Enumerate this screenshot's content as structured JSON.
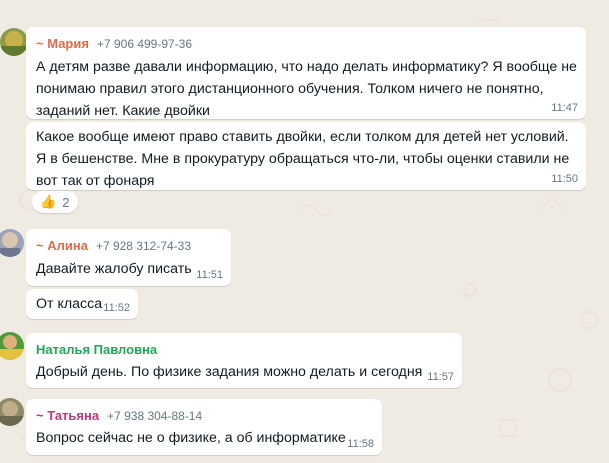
{
  "theme": {
    "background": "#efeae2",
    "bubble": "#ffffff",
    "sender_colors": {
      "maria": "#e26a4a",
      "alina": "#e26a4a",
      "natalya": "#1fa855",
      "tatyana": "#c2347e"
    }
  },
  "messages": [
    {
      "sender": "~ Мария",
      "phone": "+7 906 499-97-36",
      "lines": [
        "А детям разве давали информацию, что надо делать информатику? Я вообще не",
        "понимаю правил этого дистанционного обучения. Толком ничего не понятно,",
        "заданий нет. Какие двойки"
      ],
      "time": "11:47"
    },
    {
      "lines": [
        "Какое вообще имеют право ставить двойки, если толком для детей нет условий.",
        "Я в бешенстве. Мне в прокуратуру обращаться что-ли, чтобы оценки ставили не",
        "вот так от фонаря"
      ],
      "time": "11:50"
    },
    {
      "sender": "~ Алина",
      "phone": "+7 928 312-74-33",
      "lines": [
        "Давайте жалобу писать"
      ],
      "time": "11:51"
    },
    {
      "lines": [
        "От класса"
      ],
      "time": "11:52"
    },
    {
      "sender": "Наталья Павловна",
      "lines": [
        "Добрый день. По физике задания можно делать  и сегодня"
      ],
      "time": "11:57"
    },
    {
      "sender": "~ Татьяна",
      "phone": "+7 938 304-88-14",
      "lines": [
        "Вопрос сейчас не о физике, а об информатике"
      ],
      "time": "11:58"
    }
  ],
  "reaction": {
    "icon": "thumbs-up-icon",
    "emoji": "👍",
    "count": "2"
  }
}
